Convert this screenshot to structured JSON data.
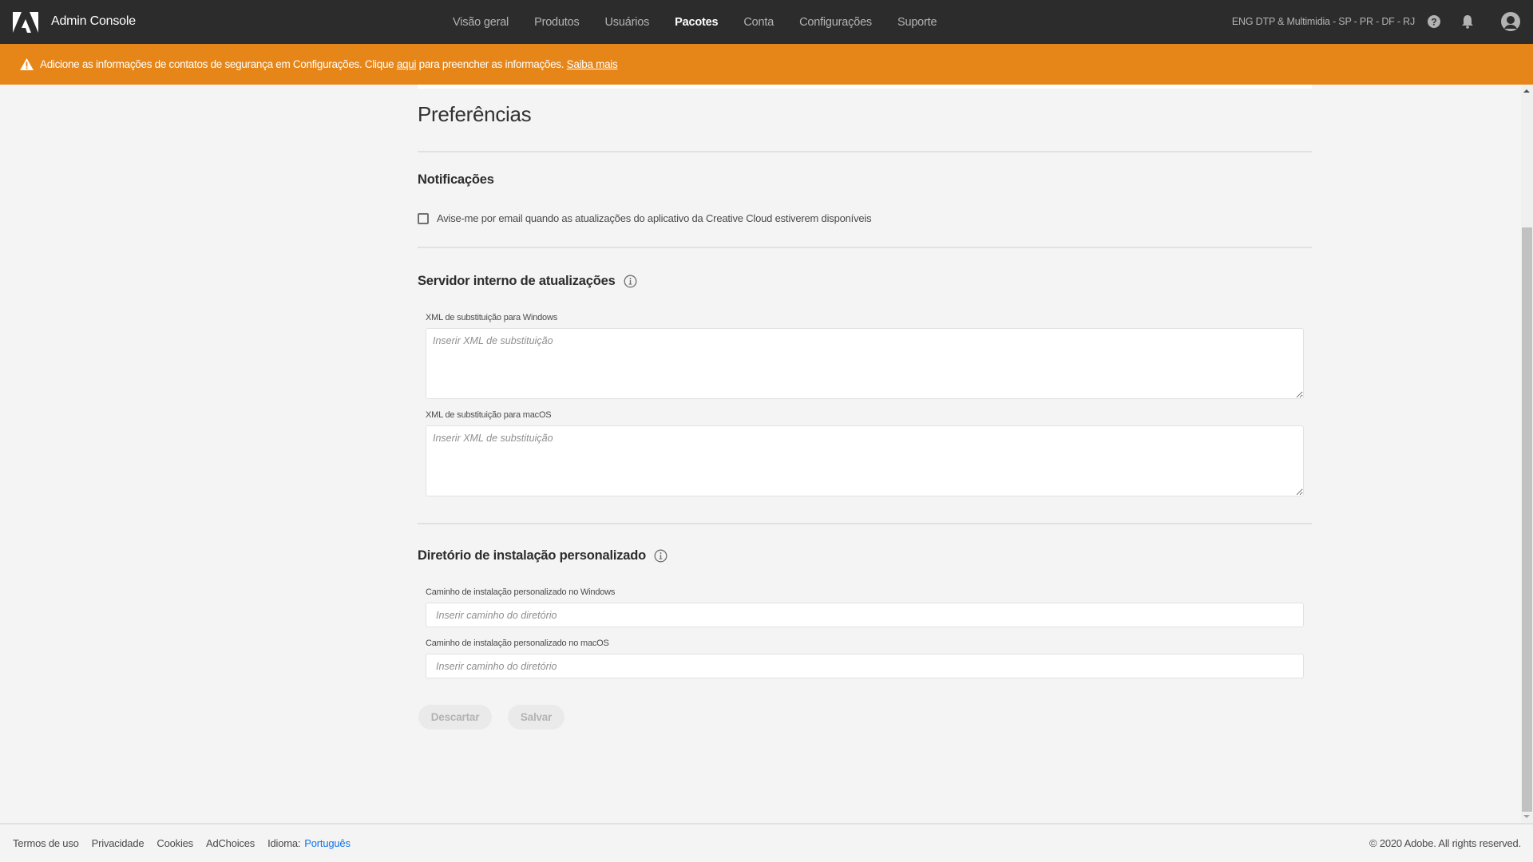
{
  "header": {
    "app_title": "Admin Console",
    "nav": [
      {
        "label": "Visão geral",
        "active": false
      },
      {
        "label": "Produtos",
        "active": false
      },
      {
        "label": "Usuários",
        "active": false
      },
      {
        "label": "Pacotes",
        "active": true
      },
      {
        "label": "Conta",
        "active": false
      },
      {
        "label": "Configurações",
        "active": false
      },
      {
        "label": "Suporte",
        "active": false
      }
    ],
    "org_name": "ENG DTP & Multimidia - SP - PR - DF - RJ",
    "icons": [
      "help-icon",
      "bell-icon",
      "avatar-icon"
    ]
  },
  "banner": {
    "icon": "warning-icon",
    "text_before": "Adicione as informações de contatos de segurança em Configurações. Clique ",
    "link_here": "aqui",
    "text_after": " para preencher as informações. ",
    "link_more": "Saiba mais",
    "color": "#e68619"
  },
  "page": {
    "title": "Preferências",
    "notifications": {
      "title": "Notificações",
      "checkbox_label": "Avise-me por email quando as atualizações do aplicativo da Creative Cloud estiverem disponíveis",
      "checked": false
    },
    "update_server": {
      "title": "Servidor interno de atualizações",
      "windows_label": "XML de substituição para Windows",
      "windows_placeholder": "Inserir XML de substituição",
      "windows_value": "",
      "mac_label": "XML de substituição para macOS",
      "mac_placeholder": "Inserir XML de substituição",
      "mac_value": ""
    },
    "install_dir": {
      "title": "Diretório de instalação personalizado",
      "windows_label": "Caminho de instalação personalizado no Windows",
      "windows_placeholder": "Inserir caminho do diretório",
      "windows_value": "",
      "mac_label": "Caminho de instalação personalizado no macOS",
      "mac_placeholder": "Inserir caminho do diretório",
      "mac_value": ""
    },
    "buttons": {
      "discard": "Descartar",
      "save": "Salvar"
    }
  },
  "footer": {
    "links": [
      "Termos de uso",
      "Privacidade",
      "Cookies",
      "AdChoices"
    ],
    "language_label": "Idioma:",
    "language_value": "Português",
    "copyright": "© 2020 Adobe. All rights reserved."
  }
}
